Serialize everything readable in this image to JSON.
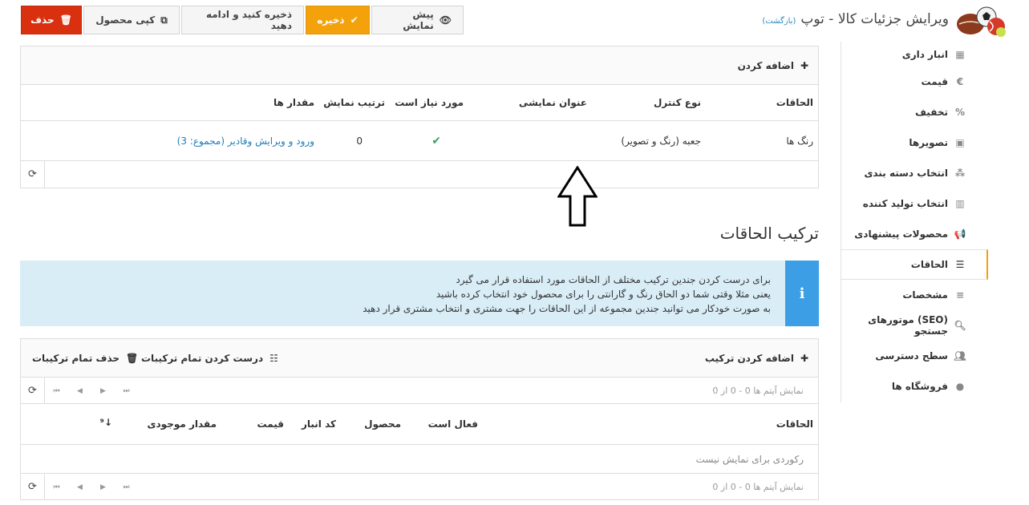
{
  "header": {
    "title": "ویرایش جزئیات کالا - توپ",
    "back_link": "(بازگشت)"
  },
  "toolbar": {
    "delete_label": "حذف",
    "copy_label": "کپی محصول",
    "save_continue_label": "ذخیره کنید و ادامه دهید",
    "save_label": "ذخیره",
    "preview_label": "پیش نمایش"
  },
  "sidebar": {
    "items": [
      {
        "label": "انبار داری",
        "icon": "archive-icon"
      },
      {
        "label": "قیمت",
        "icon": "euro-icon"
      },
      {
        "label": "تخفیف",
        "icon": "percent-icon"
      },
      {
        "label": "تصویرها",
        "icon": "image-icon"
      },
      {
        "label": "انتخاب دسته بندی",
        "icon": "sitemap-icon"
      },
      {
        "label": "انتخاب تولید کننده",
        "icon": "building-icon"
      },
      {
        "label": "محصولات پیشنهادی",
        "icon": "bullhorn-icon"
      },
      {
        "label": "الحاقات",
        "icon": "list-alt-icon"
      },
      {
        "label": "مشخصات",
        "icon": "bars-icon"
      },
      {
        "label": "(SEO) موتورهای جستجو",
        "icon": "search-icon"
      },
      {
        "label": "سطح دسترسی",
        "icon": "users-icon"
      },
      {
        "label": "فروشگاه ها",
        "icon": "globe-icon"
      }
    ],
    "active_label": "الحاقات"
  },
  "attributes_table": {
    "add_label": "اضافه کردن",
    "columns": [
      "الحاقات",
      "نوع کنترل",
      "عنوان نمایشی",
      "مورد نیاز است",
      "ترتیب نمایش",
      "مقدار ها"
    ],
    "rows": [
      {
        "attribute": "رنگ ها",
        "control_type": "جعبه (رنگ و تصویر)",
        "display_title": "",
        "required": true,
        "display_order": "0",
        "values_link": "ورود و ویرایش وقادیر (مجموع: 3)"
      }
    ]
  },
  "combinations": {
    "section_title": "ترکیب الحاقات",
    "info_lines": [
      "برای درست کردن جندین ترکیب مختلف از الحاقات مورد استفاده قرار می گیرد",
      "یعنی مثلا وقتی شما دو الحاق رنگ و گارانتی را برای محصول خود انتخاب کرده باشید",
      "به صورت خودکار می توانید جندین مجموعه از این الحاقات را جهت مشتری و انتخاب مشتری قرار دهید"
    ],
    "add_label": "اضافه کردن ترکیب",
    "generate_label": "درست کردن تمام ترکیبات",
    "delete_all_label": "حذف تمام ترکیبات",
    "pager_info": "نمایش آیتم ها 0 - 0 از 0",
    "columns": [
      "الحاقات",
      "فعال است",
      "محصول",
      "کد انبار",
      "قیمت",
      "مقدار موجودی"
    ],
    "empty_text": "رکوردی برای نمایش نیست"
  },
  "colors": {
    "delete": "#d9300f",
    "save": "#f4a20b",
    "info_bg": "#d9edf7",
    "info_badge": "#3c9ee5",
    "link": "#1f7fb8",
    "arrow_orange": "#f08a2a"
  }
}
